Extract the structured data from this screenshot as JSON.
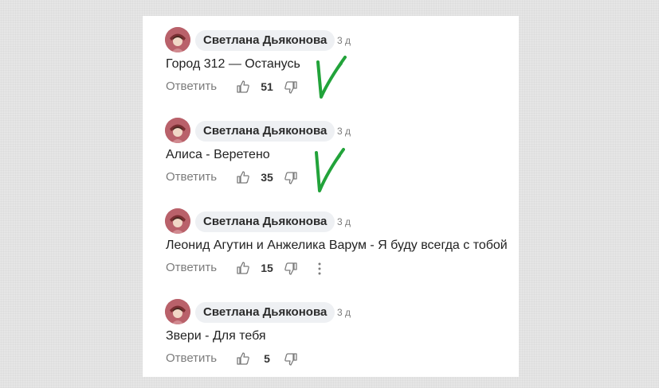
{
  "comments": [
    {
      "author": "Светлана Дьяконова",
      "time": "3 д",
      "text": "Город 312 — Останусь",
      "reply": "Ответить",
      "likes": "51",
      "more": false,
      "checked": true
    },
    {
      "author": "Светлана Дьяконова",
      "time": "3 д",
      "text": "Алиса - Веретено",
      "reply": "Ответить",
      "likes": "35",
      "more": false,
      "checked": true
    },
    {
      "author": "Светлана Дьяконова",
      "time": "3 д",
      "text": "Леонид Агутин и Анжелика Варум - Я буду всегда с тобой",
      "reply": "Ответить",
      "likes": "15",
      "more": true,
      "checked": false
    },
    {
      "author": "Светлана Дьяконова",
      "time": "3 д",
      "text": "Звери - Для тебя",
      "reply": "Ответить",
      "likes": "5",
      "more": false,
      "checked": false
    }
  ],
  "colors": {
    "check_mark": "#22a33a",
    "avatar_bg": "#b9616a"
  },
  "icons": {
    "like": "thumbs-up-icon",
    "dislike": "thumbs-down-icon",
    "more": "more-vertical-icon",
    "check": "check-mark"
  }
}
